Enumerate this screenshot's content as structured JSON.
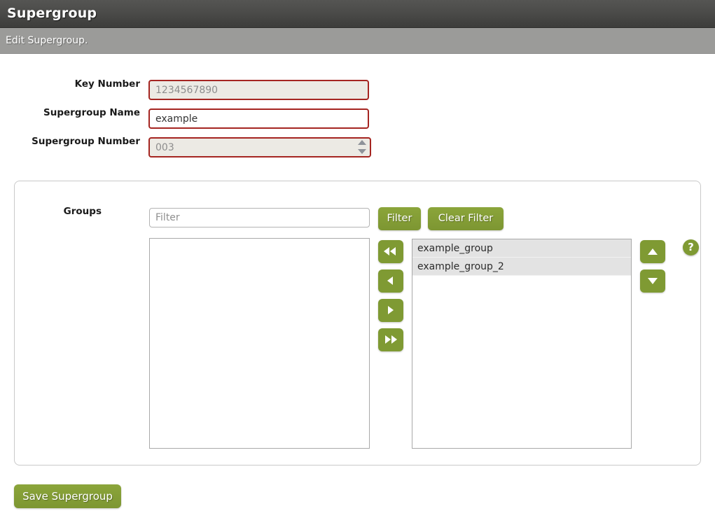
{
  "header": {
    "title": "Supergroup",
    "subtitle": "Edit Supergroup."
  },
  "form": {
    "fields": [
      {
        "label": "Key Number",
        "value": "1234567890",
        "placeholder": "",
        "disabled": true,
        "type": "text"
      },
      {
        "label": "Supergroup Name",
        "value": "example",
        "placeholder": "",
        "disabled": false,
        "type": "text"
      },
      {
        "label": "Supergroup Number",
        "value": "003",
        "placeholder": "",
        "disabled": true,
        "type": "number"
      }
    ]
  },
  "groups_panel": {
    "label": "Groups",
    "filter": {
      "value": "",
      "placeholder": "Filter"
    },
    "filter_button": "Filter",
    "clear_filter_button": "Clear Filter",
    "transfer_buttons": [
      {
        "name": "move-all-left",
        "icon": "double-left-arrow-icon"
      },
      {
        "name": "move-left",
        "icon": "left-arrow-icon"
      },
      {
        "name": "move-right",
        "icon": "right-arrow-icon"
      },
      {
        "name": "move-all-right",
        "icon": "double-right-arrow-icon"
      }
    ],
    "order_buttons": [
      {
        "name": "move-up",
        "icon": "up-arrow-icon"
      },
      {
        "name": "move-down",
        "icon": "down-arrow-icon"
      }
    ],
    "help_icon": "?",
    "available_list": {
      "name": "available-groups-list",
      "items": []
    },
    "selected_list": {
      "name": "selected-groups-list",
      "items": [
        "example_group",
        "example_group_2"
      ]
    }
  },
  "footer": {
    "save_label": "Save Supergroup"
  },
  "colors": {
    "accent_green": "#7f9a33",
    "input_border_red": "#a52521",
    "title_bar": "#4a4a48",
    "sub_bar": "#9b9b99",
    "list_item_bg": "#e3e3e3"
  }
}
